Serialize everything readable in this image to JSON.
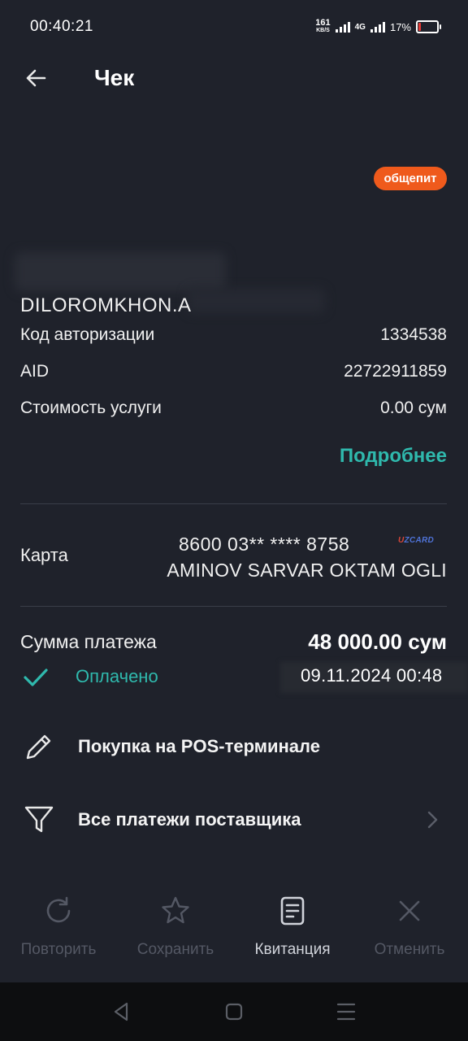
{
  "status_bar": {
    "time": "00:40:21",
    "net_speed": "161",
    "net_unit": "KB/S",
    "network": "4G",
    "battery": "17%",
    "battery_level": 0.17
  },
  "header": {
    "title": "Чек"
  },
  "badge": "общепит",
  "merchant_name": "DILOROMKHON.A",
  "details": [
    {
      "label": "Код авторизации",
      "value": "1334538"
    },
    {
      "label": "AID",
      "value": "22722911859"
    },
    {
      "label": "Стоимость услуги",
      "value": "0.00 сум"
    }
  ],
  "more_link": "Подробнее",
  "card": {
    "label": "Карта",
    "number": "8600 03** **** 8758",
    "brand_prefix": "U",
    "brand": "ZCARD",
    "holder": "AMINOV SARVAR OKTAM OGLI"
  },
  "payment": {
    "sum_label": "Сумма платежа",
    "sum_value": "48 000.00 сум",
    "status": "Оплачено",
    "datetime": "09.11.2024 00:48"
  },
  "actions": [
    {
      "label": "Покупка на POS-терминале",
      "icon": "pencil-icon"
    },
    {
      "label": "Все платежи поставщика",
      "icon": "filter-icon"
    }
  ],
  "tabs": [
    {
      "label": "Повторить",
      "icon": "refresh-icon",
      "enabled": false
    },
    {
      "label": "Сохранить",
      "icon": "star-icon",
      "enabled": false
    },
    {
      "label": "Квитанция",
      "icon": "receipt-icon",
      "enabled": true
    },
    {
      "label": "Отменить",
      "icon": "close-icon",
      "enabled": false
    }
  ],
  "colors": {
    "background": "#1f222b",
    "accent": "#2fb9ad",
    "badge": "#ef5a1c",
    "disabled": "#545864"
  }
}
